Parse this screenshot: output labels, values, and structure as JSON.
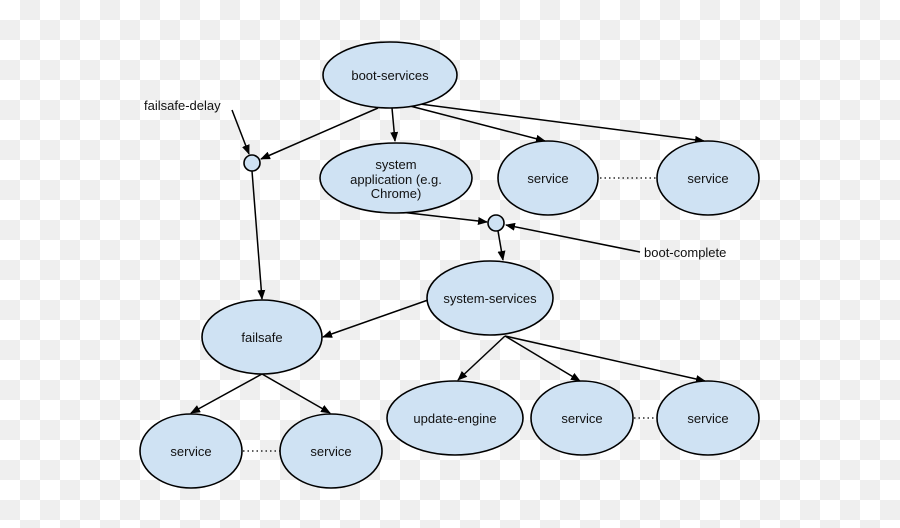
{
  "colors": {
    "node_fill": "#cfe2f3",
    "stroke": "#000000"
  },
  "nodes": {
    "boot_services": "boot-services",
    "system_application": [
      "system",
      "application (e.g.",
      "Chrome)"
    ],
    "service": "service",
    "system_services": "system-services",
    "failsafe": "failsafe",
    "update_engine": "update-engine"
  },
  "labels": {
    "failsafe_delay": "failsafe-delay",
    "boot_complete": "boot-complete"
  }
}
